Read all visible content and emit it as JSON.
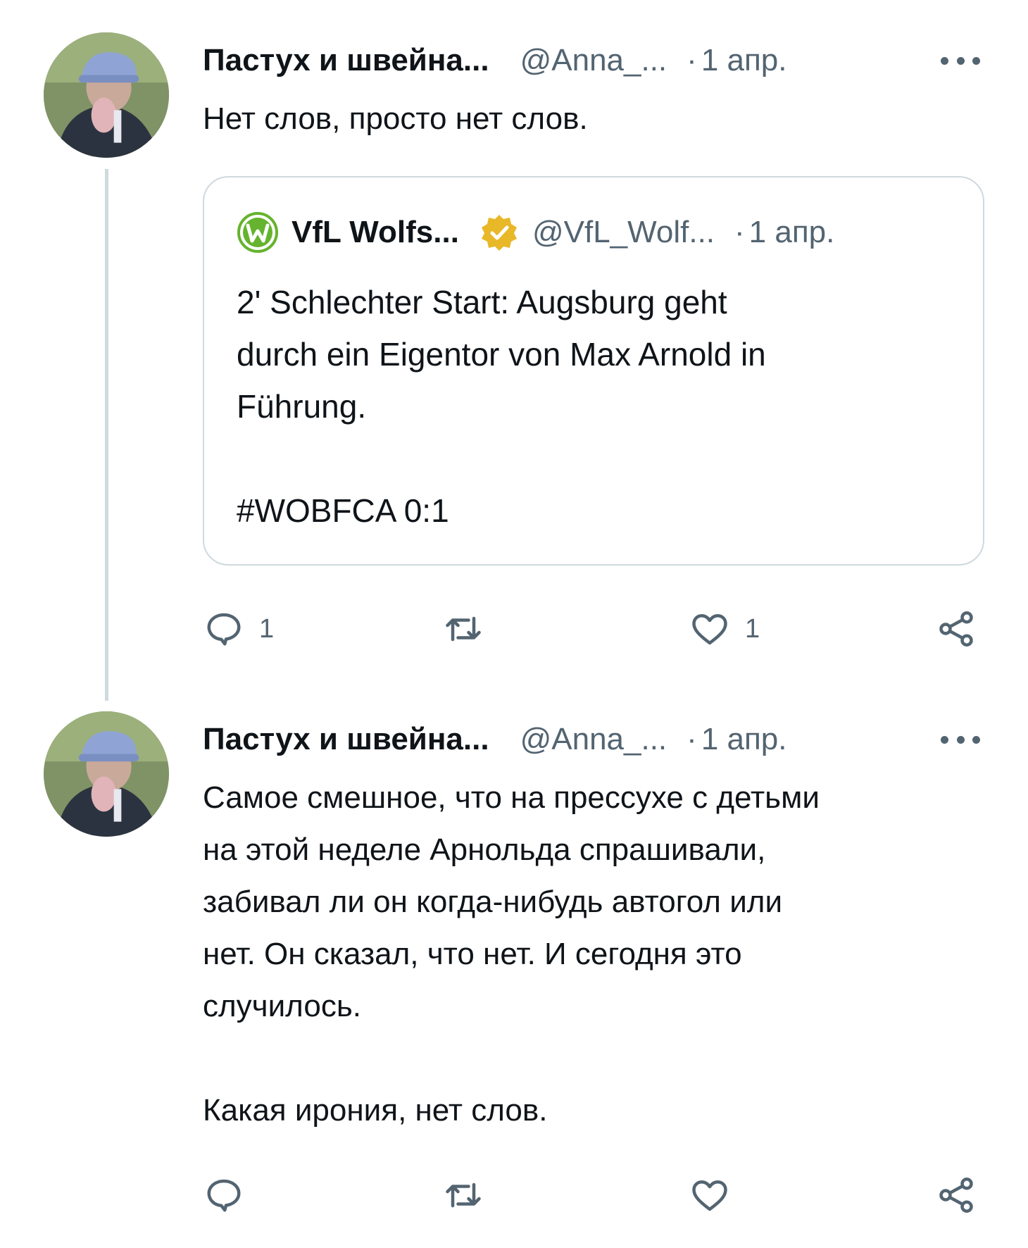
{
  "tweets": [
    {
      "author_name": "Пастух и швейна...",
      "handle": "@Anna_...",
      "separator": "·",
      "date": "1 апр.",
      "text": "Нет слов, просто нет слов.",
      "avatar_icon": "user-avatar-photo",
      "quote": {
        "logo_icon": "vfl-wolfsburg-logo",
        "author_name": "VfL Wolfs...",
        "verified_icon": "verified-gold-badge-icon",
        "handle": "@VfL_Wolf...",
        "separator": "·",
        "date": "1 апр.",
        "text": "2' Schlechter Start: Augsburg geht\ndurch ein Eigentor von Max Arnold in\nFührung.\n\n#WOBFCA 0:1"
      },
      "actions": {
        "reply_count": "1",
        "retweet_count": "",
        "like_count": "1"
      }
    },
    {
      "author_name": "Пастух и швейна...",
      "handle": "@Anna_...",
      "separator": "·",
      "date": "1 апр.",
      "text": "Самое смешное, что на прессухе с детьми\nна этой неделе Арнольда спрашивали,\nзабивал ли он когда-нибудь автогол или\nнет. Он сказал, что нет. И сегодня это\nслучилось.\n\nКакая ирония, нет слов.",
      "avatar_icon": "user-avatar-photo",
      "actions": {
        "reply_count": "",
        "retweet_count": "",
        "like_count": ""
      }
    }
  ],
  "colors": {
    "text_primary": "#0f1419",
    "text_secondary": "#536471",
    "border": "#cfd9de",
    "verified_gold": "#e8b829",
    "wolfsburg_green": "#65b32e"
  }
}
